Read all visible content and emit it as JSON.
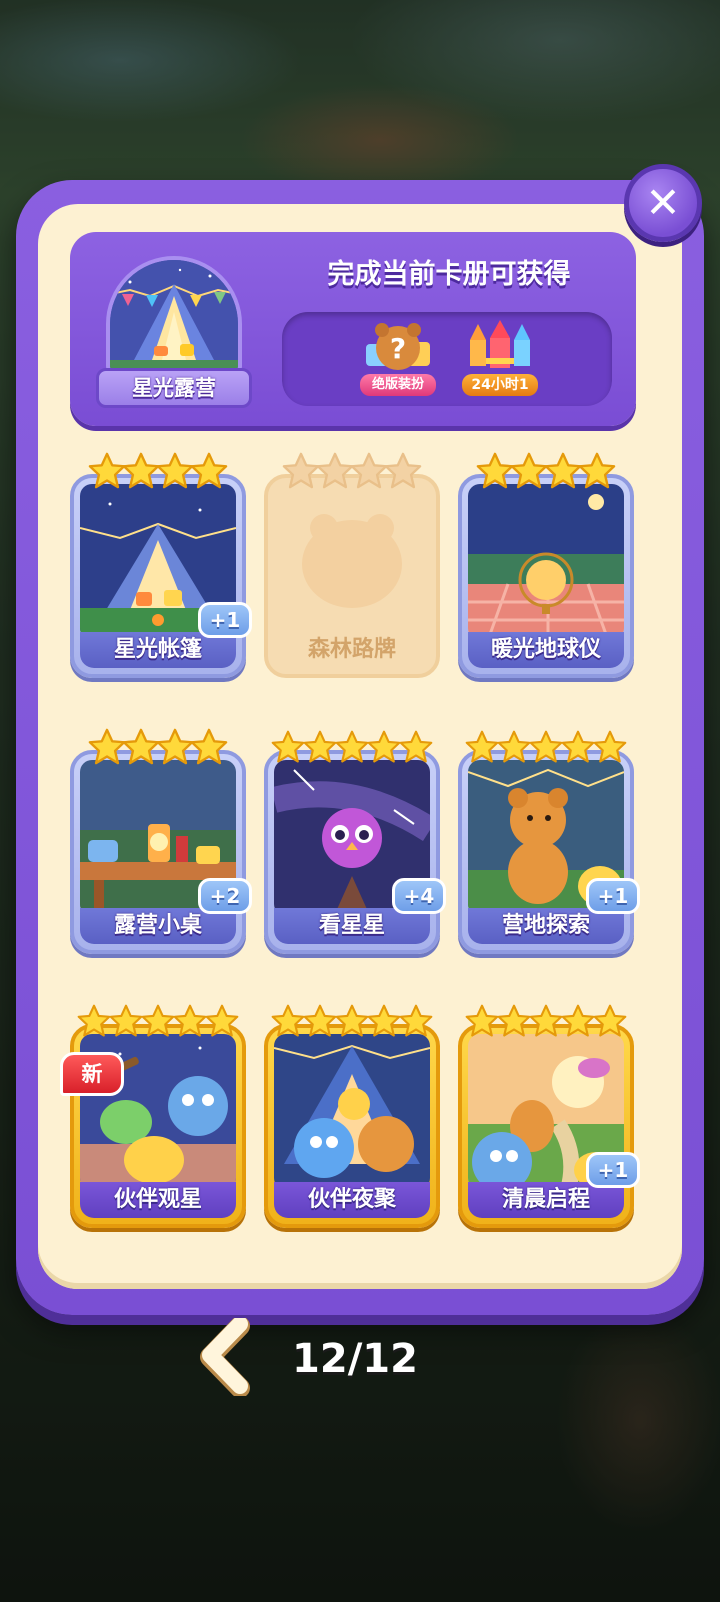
{
  "header": {
    "album_name": "星光露营",
    "title": "完成当前卡册可获得",
    "rewards": [
      {
        "label": "绝版装扮",
        "icon": "mystery-bear-gift-icon"
      },
      {
        "label": "24小时1",
        "icon": "firework-rocket-icon"
      }
    ]
  },
  "cards": [
    {
      "name": "星光帐篷",
      "stars": 4,
      "tier": "silver",
      "count_badge": "+1",
      "icon": "glowing-tent-scene"
    },
    {
      "name": "森林路牌",
      "stars": 4,
      "tier": "empty",
      "count_badge": "",
      "icon": "locked-card-silhouette"
    },
    {
      "name": "暖光地球仪",
      "stars": 4,
      "tier": "silver",
      "count_badge": "",
      "icon": "glowing-globe-scene"
    },
    {
      "name": "露营小桌",
      "stars": 4,
      "tier": "silver",
      "count_badge": "+2",
      "icon": "camp-table-lantern-scene"
    },
    {
      "name": "看星星",
      "stars": 5,
      "tier": "silver",
      "count_badge": "+4",
      "icon": "owl-starry-sky-scene"
    },
    {
      "name": "营地探索",
      "stars": 5,
      "tier": "silver",
      "count_badge": "+1",
      "icon": "bear-campsite-scene"
    },
    {
      "name": "伙伴观星",
      "stars": 5,
      "tier": "gold",
      "count_badge": "",
      "new_badge": "新",
      "icon": "friends-telescope-scene"
    },
    {
      "name": "伙伴夜聚",
      "stars": 5,
      "tier": "gold",
      "count_badge": "",
      "icon": "friends-night-party-scene"
    },
    {
      "name": "清晨启程",
      "stars": 5,
      "tier": "gold",
      "count_badge": "+1",
      "icon": "friends-sunrise-scene"
    }
  ],
  "pager": {
    "text": "12/12"
  },
  "colors": {
    "panel": "#7a4fd4",
    "panel_inner": "#fdf1d2",
    "silver_frame": "#a8b2ec",
    "gold_frame": "#f0b21a"
  }
}
